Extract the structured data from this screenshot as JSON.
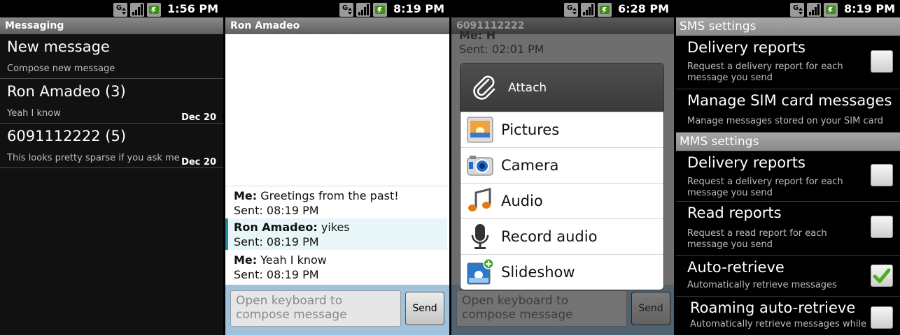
{
  "status_times": [
    "1:56 PM",
    "8:19 PM",
    "6:28 PM",
    "8:19 PM"
  ],
  "screen1": {
    "title": "Messaging",
    "items": [
      {
        "title": "New message",
        "subtitle": "Compose new message",
        "date": ""
      },
      {
        "title": "Ron Amadeo (3)",
        "subtitle": "Yeah I know",
        "date": "Dec 20"
      },
      {
        "title": "6091112222 (5)",
        "subtitle": "This looks pretty sparse if you ask me",
        "date": "Dec 20"
      }
    ]
  },
  "screen2": {
    "title": "Ron Amadeo",
    "messages": [
      {
        "sender": "Me:",
        "text": " Greetings from the past!",
        "sent": "Sent: 08:19 PM"
      },
      {
        "sender": "Ron Amadeo:",
        "text": " yikes",
        "sent": "Sent: 08:19 PM"
      },
      {
        "sender": "Me:",
        "text": " Yeah I know",
        "sent": "Sent: 08:19 PM"
      }
    ],
    "compose_placeholder": "Open keyboard to compose message",
    "send_label": "Send"
  },
  "screen3": {
    "title": "6091112222",
    "bg_partial": "Me: H",
    "bg_sent": "Sent: 02:01 PM",
    "dialog_title": "Attach",
    "items": [
      {
        "label": "Pictures",
        "icon": "pictures-icon"
      },
      {
        "label": "Camera",
        "icon": "camera-icon"
      },
      {
        "label": "Audio",
        "icon": "audio-icon"
      },
      {
        "label": "Record audio",
        "icon": "microphone-icon"
      },
      {
        "label": "Slideshow",
        "icon": "slideshow-icon"
      }
    ],
    "compose_placeholder": "Open keyboard to compose message",
    "send_label": "Send"
  },
  "screen4": {
    "sms_header": "SMS settings",
    "mms_header": "MMS settings",
    "sms_prefs": [
      {
        "title": "Delivery reports",
        "subtitle": "Request a delivery report for each message you send",
        "checked": false
      },
      {
        "title": "Manage SIM card messages",
        "subtitle": "Manage messages stored on your SIM card",
        "checked": null
      }
    ],
    "mms_prefs": [
      {
        "title": "Delivery reports",
        "subtitle": "Request a delivery report for each message you send",
        "checked": false
      },
      {
        "title": "Read reports",
        "subtitle": "Request a read report for each message you send",
        "checked": false
      },
      {
        "title": "Auto-retrieve",
        "subtitle": "Automatically retrieve messages",
        "checked": true
      },
      {
        "title": "Roaming auto-retrieve",
        "subtitle": "Automatically retrieve messages while",
        "checked": false
      }
    ]
  }
}
